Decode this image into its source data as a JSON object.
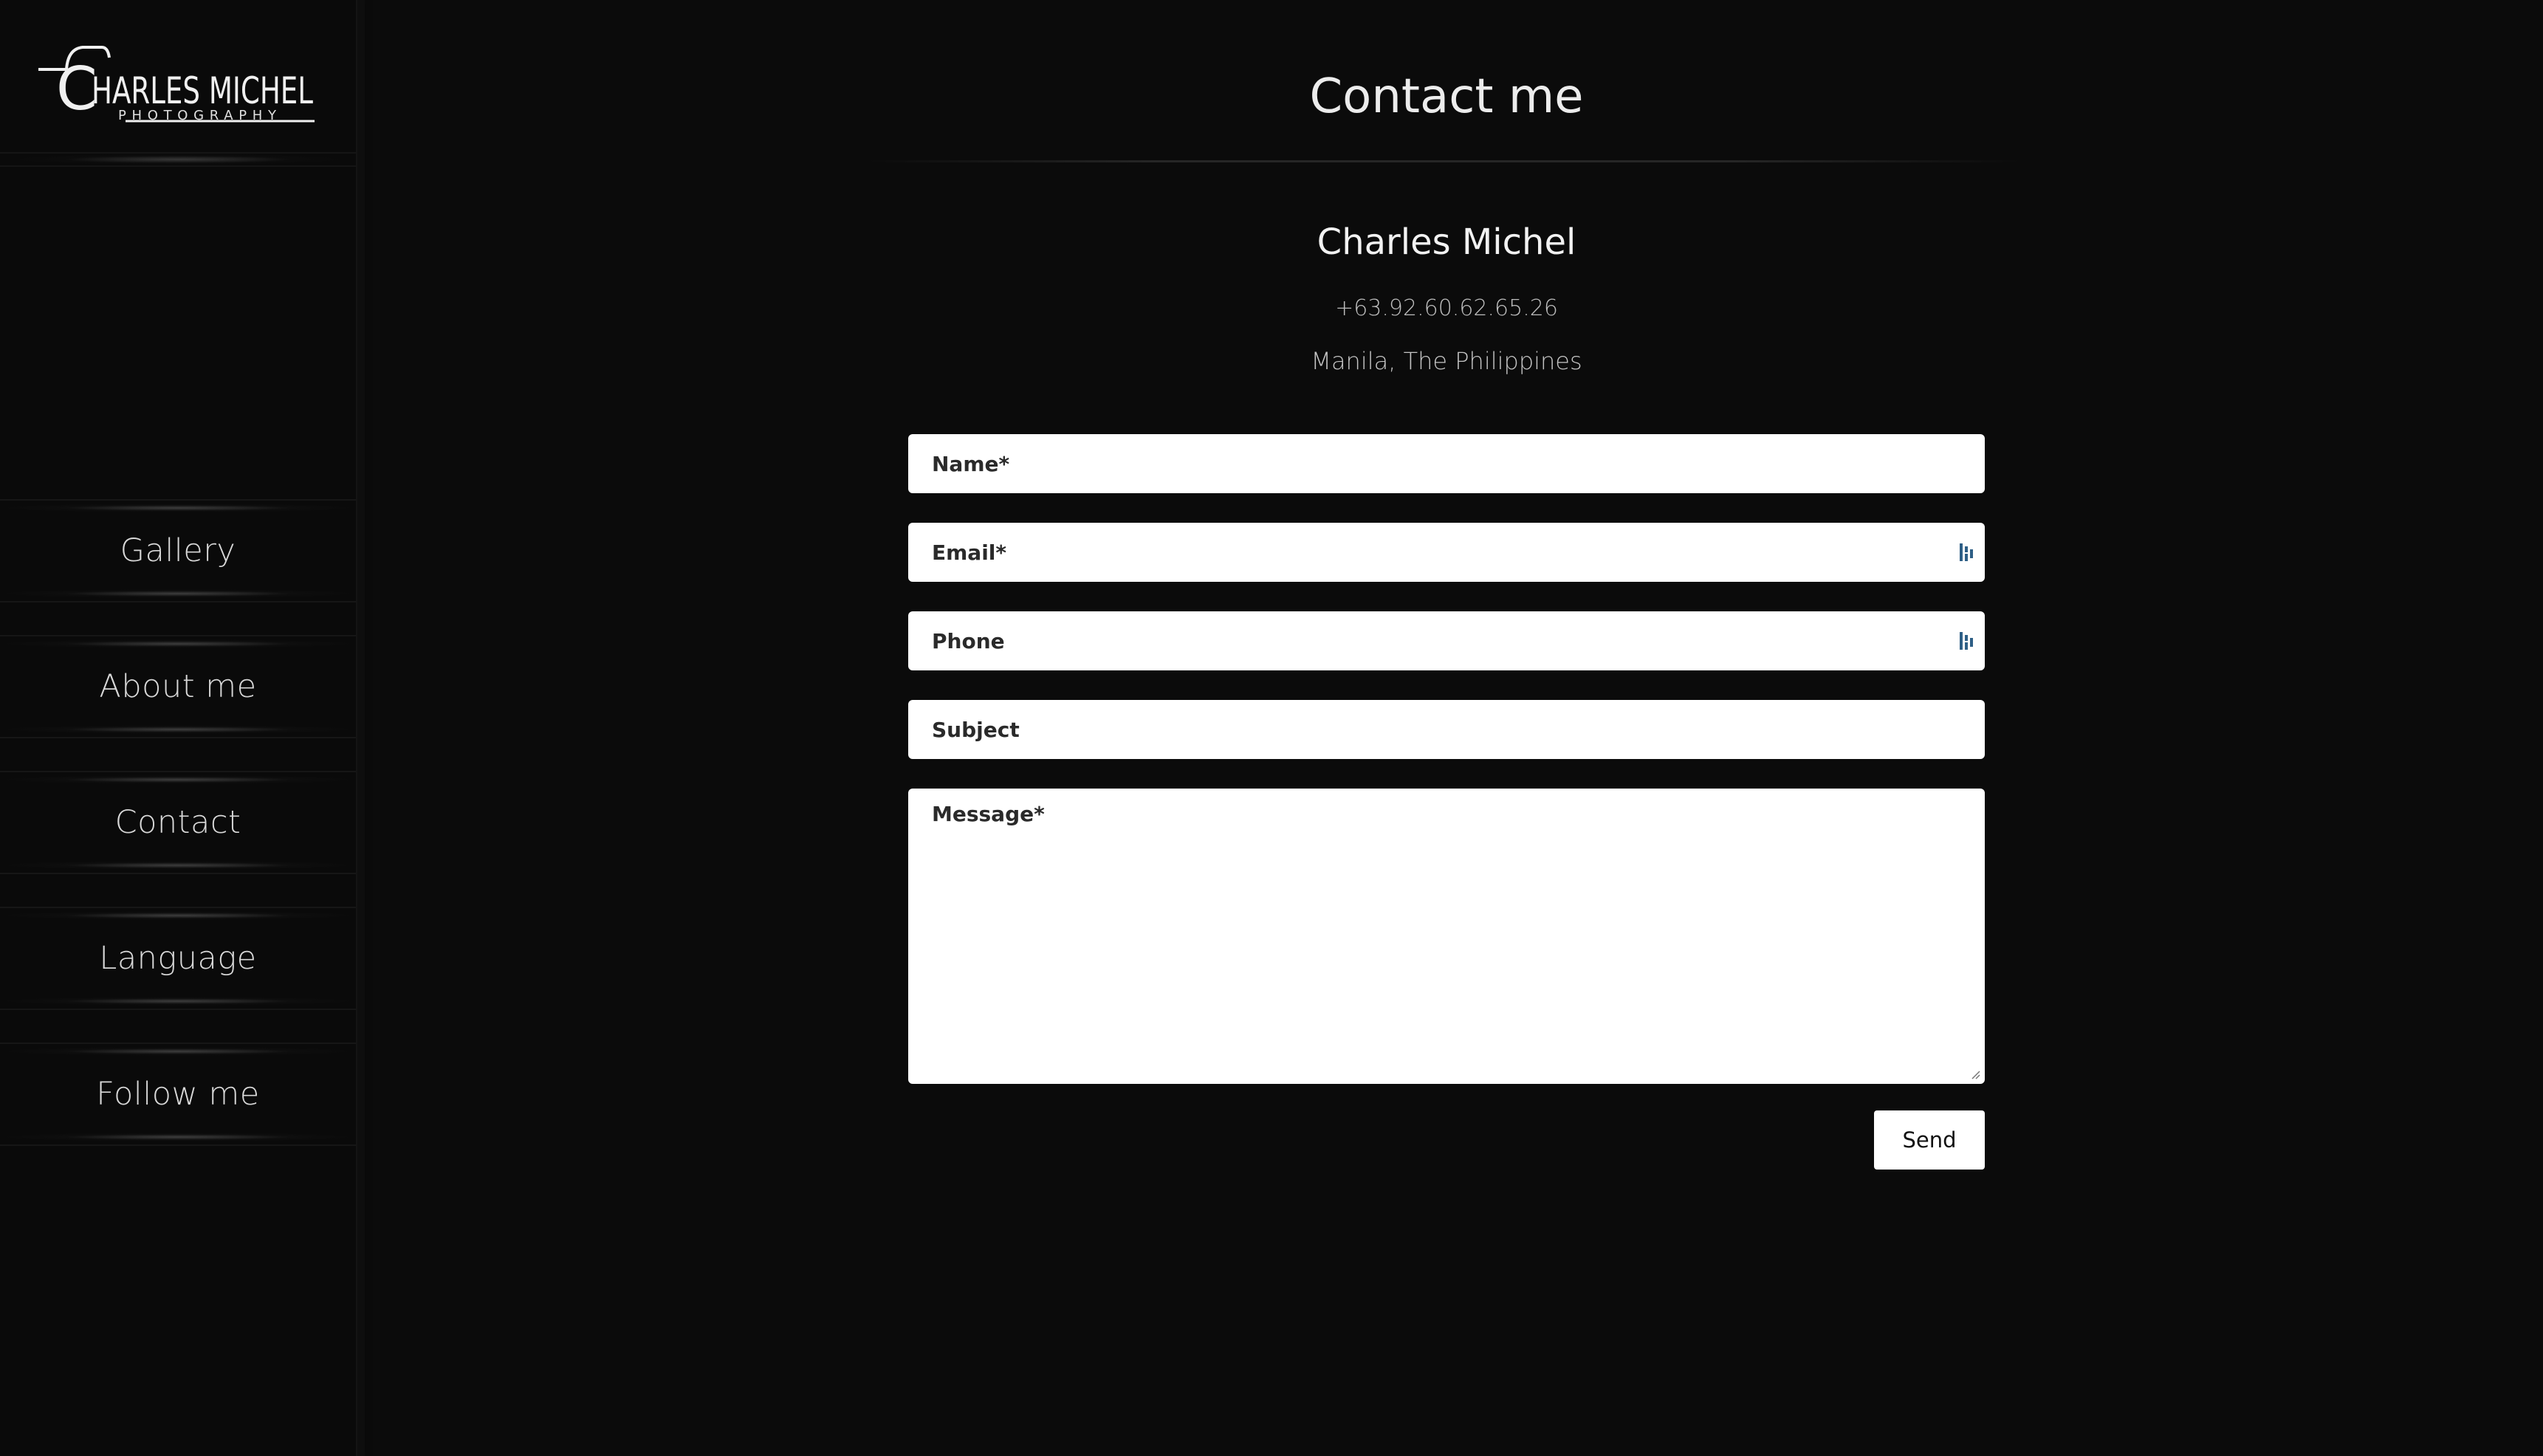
{
  "brand": {
    "name": "HARLES MICHEL",
    "initial": "C",
    "tagline": "PHOTOGRAPHY"
  },
  "sidebar": {
    "items": [
      {
        "label": "Gallery"
      },
      {
        "label": "About me"
      },
      {
        "label": "Contact"
      },
      {
        "label": "Language"
      },
      {
        "label": "Follow me"
      }
    ]
  },
  "main": {
    "title": "Contact me",
    "owner": {
      "name": "Charles Michel",
      "phone": "+63.92.60.62.65.26",
      "location": "Manila, The Philippines"
    },
    "form": {
      "name_placeholder": "Name*",
      "email_placeholder": "Email*",
      "phone_placeholder": "Phone",
      "subject_placeholder": "Subject",
      "message_placeholder": "Message*",
      "send_label": "Send"
    }
  },
  "colors": {
    "background": "#0b0b0b",
    "sidebar": "#0a0a0a",
    "text": "#ececec",
    "field": "#ffffff",
    "autofill_icon": "#2e5f86"
  }
}
